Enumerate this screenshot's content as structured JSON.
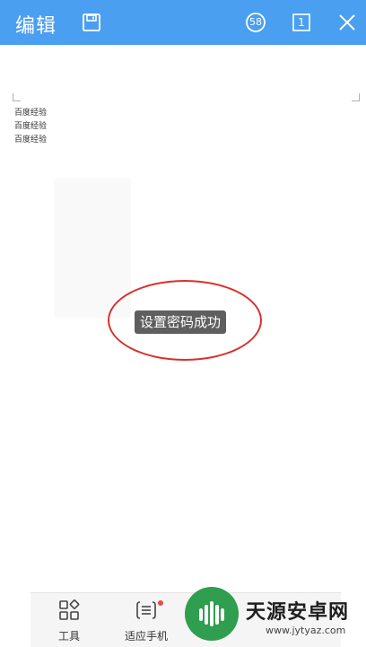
{
  "topbar": {
    "title": "编辑",
    "counter_badge": "58",
    "page_number": "1",
    "icons": [
      "save-icon",
      "counter-icon",
      "page-icon",
      "close-icon"
    ],
    "background": "#4a9ff0"
  },
  "document": {
    "lines": [
      "百度经验",
      "百度经验",
      "百度经验"
    ]
  },
  "toast": {
    "message": "设置密码成功",
    "annotation_color": "#d9302c"
  },
  "bottom_toolbar": {
    "items": [
      {
        "label": "工具",
        "icon": "grid-tools-icon"
      },
      {
        "label": "适应手机",
        "icon": "fit-phone-icon"
      }
    ]
  },
  "watermark": {
    "title": "天源安卓网",
    "url": "www.jytyaz.com"
  }
}
